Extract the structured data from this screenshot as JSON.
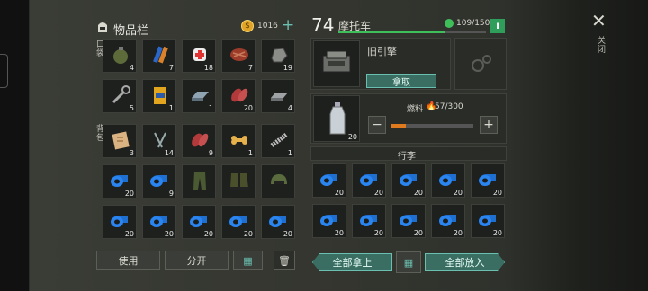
{
  "inventory": {
    "title": "物品栏",
    "coins": "1016",
    "pockets_label": "口袋",
    "backpack_label": "背包",
    "pocket_slots": [
      {
        "icon": "grenade-icon",
        "count": "4"
      },
      {
        "icon": "battery-icon",
        "count": "7"
      },
      {
        "icon": "bandage-icon",
        "count": "18"
      },
      {
        "icon": "steak-icon",
        "count": "7"
      },
      {
        "icon": "stone-icon",
        "count": "19"
      },
      {
        "icon": "wrench-icon",
        "count": "5"
      },
      {
        "icon": "snack-bag-icon",
        "count": "1"
      },
      {
        "icon": "iron-bar-icon",
        "count": "1"
      },
      {
        "icon": "raw-meat-icon",
        "count": "20"
      },
      {
        "icon": "metal-ingot-icon",
        "count": "4"
      }
    ],
    "backpack_slots": [
      {
        "icon": "crafting-paper-icon",
        "count": "3"
      },
      {
        "icon": "nails-icon",
        "count": "14"
      },
      {
        "icon": "raw-meat-icon",
        "count": "9"
      },
      {
        "icon": "dog-bone-icon",
        "count": "1"
      },
      {
        "icon": "spring-icon",
        "count": "1"
      },
      {
        "icon": "tape-icon",
        "count": "20"
      },
      {
        "icon": "tape-icon",
        "count": "9"
      },
      {
        "icon": "pants-icon",
        "count": ""
      },
      {
        "icon": "boots-icon",
        "count": ""
      },
      {
        "icon": "helmet-icon",
        "count": ""
      },
      {
        "icon": "tape-icon",
        "count": "20"
      },
      {
        "icon": "tape-icon",
        "count": "20"
      },
      {
        "icon": "tape-icon",
        "count": "20"
      },
      {
        "icon": "tape-icon",
        "count": "20"
      },
      {
        "icon": "tape-icon",
        "count": "20"
      }
    ],
    "use_label": "使用",
    "split_label": "分开"
  },
  "vehicle": {
    "level": "74",
    "name": "摩托车",
    "durability": "109/150",
    "durability_fraction": 0.727,
    "part_name": "旧引擎",
    "take_label": "拿取",
    "fuel_label": "燃料",
    "fuel_value": "57/300",
    "fuel_fraction": 0.19,
    "fuel_item_count": "20",
    "luggage_title": "行李",
    "luggage_slots": [
      {
        "icon": "tape-icon",
        "count": "20"
      },
      {
        "icon": "tape-icon",
        "count": "20"
      },
      {
        "icon": "tape-icon",
        "count": "20"
      },
      {
        "icon": "tape-icon",
        "count": "20"
      },
      {
        "icon": "tape-icon",
        "count": "20"
      },
      {
        "icon": "tape-icon",
        "count": "20"
      },
      {
        "icon": "tape-icon",
        "count": "20"
      },
      {
        "icon": "tape-icon",
        "count": "20"
      },
      {
        "icon": "tape-icon",
        "count": "20"
      },
      {
        "icon": "tape-icon",
        "count": "20"
      }
    ],
    "take_all_label": "全部拿上",
    "put_all_label": "全部放入"
  },
  "close_label": "关闭",
  "colors": {
    "accent": "#6bbfb0",
    "bar_green": "#3fbf5a",
    "fuel_orange": "#e07a1f",
    "info_green": "#2e9e5a"
  }
}
